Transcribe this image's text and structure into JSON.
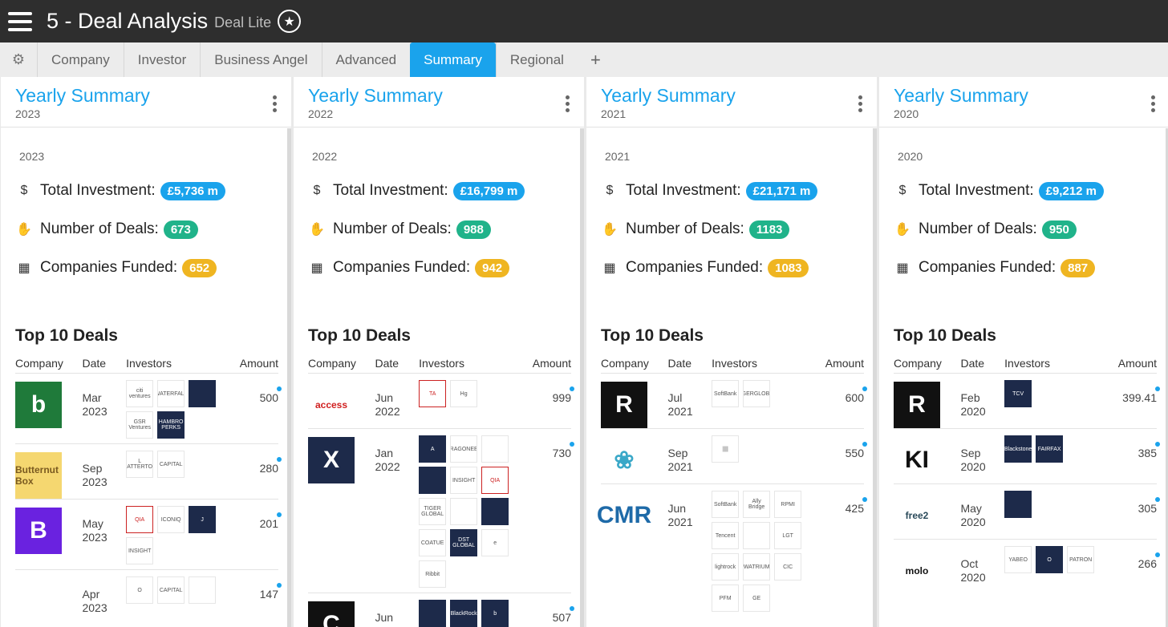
{
  "header": {
    "title": "5 - Deal Analysis",
    "subtitle": "Deal Lite"
  },
  "tabs": [
    "Company",
    "Investor",
    "Business Angel",
    "Advanced",
    "Summary",
    "Regional"
  ],
  "labels": {
    "panel_title": "Yearly Summary",
    "total_investment": "Total Investment:",
    "number_of_deals": "Number of Deals:",
    "companies_funded": "Companies Funded:",
    "top_deals": "Top 10 Deals",
    "col_company": "Company",
    "col_date": "Date",
    "col_investors": "Investors",
    "col_amount": "Amount"
  },
  "panels": [
    {
      "year": "2023",
      "total": "£5,736 m",
      "deals": "673",
      "companies": "652",
      "rows": [
        {
          "logo_text": "b",
          "logo_bg": "#1f7a3a",
          "logo_fg": "#ffffff",
          "month": "Mar",
          "year": "2023",
          "amount": "500",
          "investors": [
            {
              "t": "citi ventures",
              "k": "light"
            },
            {
              "t": "WATERFALL",
              "k": "light"
            },
            {
              "t": "",
              "k": "dark"
            },
            {
              "t": "GSR Ventures",
              "k": "light"
            },
            {
              "t": "HAMBRO PERKS",
              "k": "dark"
            }
          ]
        },
        {
          "logo_text": "Butternut Box",
          "logo_bg": "#f5d770",
          "logo_fg": "#7a5a20",
          "month": "Sep",
          "year": "2023",
          "amount": "280",
          "investors": [
            {
              "t": "L CATTERTON",
              "k": "light"
            },
            {
              "t": "CAPITAL",
              "k": "light"
            }
          ]
        },
        {
          "logo_text": "B",
          "logo_bg": "#6a22e0",
          "logo_fg": "#ffffff",
          "month": "May",
          "year": "2023",
          "amount": "201",
          "investors": [
            {
              "t": "QIA",
              "k": "red"
            },
            {
              "t": "ICONIQ",
              "k": "light"
            },
            {
              "t": "J",
              "k": "dark"
            },
            {
              "t": "INSIGHT",
              "k": "light"
            }
          ]
        },
        {
          "logo_text": "",
          "logo_bg": "#ffffff",
          "logo_fg": "#1a3a4a",
          "month": "Apr",
          "year": "2023",
          "amount": "147",
          "investors": [
            {
              "t": "O",
              "k": "light"
            },
            {
              "t": "CAPITAL",
              "k": "light"
            },
            {
              "t": "",
              "k": "light"
            }
          ]
        }
      ]
    },
    {
      "year": "2022",
      "total": "£16,799 m",
      "deals": "988",
      "companies": "942",
      "rows": [
        {
          "logo_text": "access",
          "logo_bg": "#ffffff",
          "logo_fg": "#d02020",
          "month": "Jun",
          "year": "2022",
          "amount": "999",
          "investors": [
            {
              "t": "TA",
              "k": "red"
            },
            {
              "t": "Hg",
              "k": "light"
            }
          ]
        },
        {
          "logo_text": "X",
          "logo_bg": "#1d2a4a",
          "logo_fg": "#ffffff",
          "month": "Jan",
          "year": "2022",
          "amount": "730",
          "investors": [
            {
              "t": "A",
              "k": "dark"
            },
            {
              "t": "DRAGONEER",
              "k": "light"
            },
            {
              "t": "",
              "k": "light"
            },
            {
              "t": "",
              "k": "dark"
            },
            {
              "t": "INSIGHT",
              "k": "light"
            },
            {
              "t": "QIA",
              "k": "red"
            },
            {
              "t": "TIGER GLOBAL",
              "k": "light"
            },
            {
              "t": "",
              "k": "light"
            },
            {
              "t": "",
              "k": "dark"
            },
            {
              "t": "COATUE",
              "k": "light"
            },
            {
              "t": "DST GLOBAL",
              "k": "dark"
            },
            {
              "t": "e",
              "k": "light"
            },
            {
              "t": "Ribbit",
              "k": "light"
            }
          ]
        },
        {
          "logo_text": "C",
          "logo_bg": "#111111",
          "logo_fg": "#ffffff",
          "month": "Jun",
          "year": "2022",
          "amount": "507",
          "investors": [
            {
              "t": "",
              "k": "dark"
            },
            {
              "t": "BlackRock",
              "k": "dark"
            },
            {
              "t": "b",
              "k": "dark"
            }
          ]
        }
      ]
    },
    {
      "year": "2021",
      "total": "£21,171 m",
      "deals": "1183",
      "companies": "1083",
      "rows": [
        {
          "logo_text": "R",
          "logo_bg": "#111111",
          "logo_fg": "#ffffff",
          "month": "Jul",
          "year": "2021",
          "amount": "600",
          "investors": [
            {
              "t": "SoftBank",
              "k": "light"
            },
            {
              "t": "TIGERGLOBAL",
              "k": "light"
            }
          ]
        },
        {
          "logo_text": "❀",
          "logo_bg": "#ffffff",
          "logo_fg": "#3aa8c8",
          "month": "Sep",
          "year": "2021",
          "amount": "550",
          "investors": [
            {
              "t": "||||",
              "k": "light"
            }
          ]
        },
        {
          "logo_text": "CMR",
          "logo_bg": "#ffffff",
          "logo_fg": "#1e6aa8",
          "month": "Jun",
          "year": "2021",
          "amount": "425",
          "investors": [
            {
              "t": "SoftBank",
              "k": "light"
            },
            {
              "t": "Ally Bridge",
              "k": "light"
            },
            {
              "t": "RPMI",
              "k": "light"
            },
            {
              "t": "Tencent",
              "k": "light"
            },
            {
              "t": "",
              "k": "light"
            },
            {
              "t": "LGT",
              "k": "light"
            },
            {
              "t": "lightrock",
              "k": "light"
            },
            {
              "t": "WATRIUM",
              "k": "light"
            },
            {
              "t": "CIC",
              "k": "light"
            },
            {
              "t": "PFM",
              "k": "light"
            },
            {
              "t": "GE",
              "k": "light"
            }
          ]
        }
      ]
    },
    {
      "year": "2020",
      "total": "£9,212 m",
      "deals": "950",
      "companies": "887",
      "rows": [
        {
          "logo_text": "R",
          "logo_bg": "#111111",
          "logo_fg": "#ffffff",
          "month": "Feb",
          "year": "2020",
          "amount": "399.41",
          "investors": [
            {
              "t": "TCV",
              "k": "dark"
            }
          ]
        },
        {
          "logo_text": "KI",
          "logo_bg": "#ffffff",
          "logo_fg": "#111111",
          "month": "Sep",
          "year": "2020",
          "amount": "385",
          "investors": [
            {
              "t": "Blackstone",
              "k": "dark"
            },
            {
              "t": "FAIRFAX",
              "k": "dark"
            }
          ]
        },
        {
          "logo_text": "free2",
          "logo_bg": "#ffffff",
          "logo_fg": "#2a4a5a",
          "month": "May",
          "year": "2020",
          "amount": "305",
          "investors": [
            {
              "t": "",
              "k": "dark"
            }
          ]
        },
        {
          "logo_text": "molo",
          "logo_bg": "#ffffff",
          "logo_fg": "#111111",
          "month": "Oct",
          "year": "2020",
          "amount": "266",
          "investors": [
            {
              "t": "YABEO",
              "k": "light"
            },
            {
              "t": "O",
              "k": "dark"
            },
            {
              "t": "PATRON",
              "k": "light"
            }
          ]
        }
      ]
    }
  ]
}
